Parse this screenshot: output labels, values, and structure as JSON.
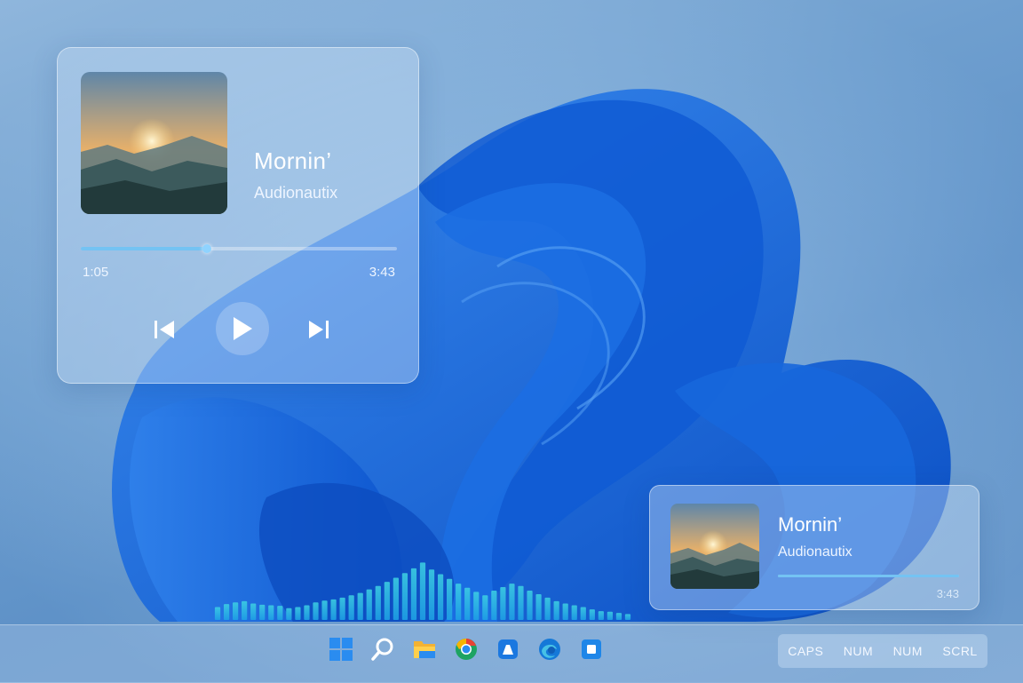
{
  "player": {
    "title": "Mornin’",
    "artist": "Audionautix",
    "elapsed": "1:05",
    "total": "3:43",
    "progress_fraction": 0.4
  },
  "mini_player": {
    "title": "Mornin’",
    "artist": "Audionautix",
    "total": "3:43",
    "progress_fraction": 1.0
  },
  "visualizer": {
    "levels": [
      0.22,
      0.27,
      0.3,
      0.32,
      0.28,
      0.26,
      0.25,
      0.24,
      0.2,
      0.22,
      0.25,
      0.3,
      0.33,
      0.35,
      0.38,
      0.42,
      0.46,
      0.52,
      0.58,
      0.65,
      0.72,
      0.8,
      0.88,
      0.98,
      0.86,
      0.78,
      0.7,
      0.62,
      0.55,
      0.48,
      0.42,
      0.5,
      0.56,
      0.62,
      0.58,
      0.5,
      0.44,
      0.38,
      0.32,
      0.28,
      0.25,
      0.22,
      0.18,
      0.15,
      0.14,
      0.12,
      0.1
    ],
    "colors": [
      "#1fa3e6",
      "#3ed3e3"
    ]
  },
  "taskbar": {
    "icons": [
      "start-icon",
      "search-icon",
      "file-explorer-icon",
      "chrome-icon",
      "store-icon",
      "edge-icon",
      "app-icon"
    ]
  },
  "tray": {
    "indicators": [
      "CAPS",
      "NUM",
      "NUM",
      "SCRL"
    ]
  },
  "colors": {
    "accent": "#74c3f3",
    "wallpaper_blue": "#1a6fe0"
  }
}
